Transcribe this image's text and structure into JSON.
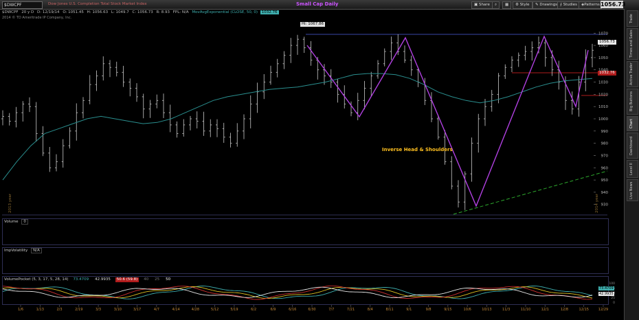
{
  "topbar": {
    "symbol": "$DWCPF",
    "description": "Dow Jones U.S. Completion Total Stock Market Index",
    "title": "Small Cap Daily",
    "buttons": [
      "Share",
      "Style",
      "Drawings",
      "Studies",
      "Patterns"
    ],
    "last_price": "1056.73"
  },
  "quote": {
    "symbol": "$DWCPF",
    "period": "20 y",
    "interval": "D",
    "date": "D: 12/19/14",
    "open": "O: 1051.45",
    "high": "H: 1056.63",
    "low": "L: 1049.7",
    "close": "C: 1056.73",
    "range": "R: 8.93",
    "fpl": "FPL: N/A",
    "study": "MovAvgExponential (CLOSE, 50, 0)",
    "study_value": "1032.76"
  },
  "copyright": "2014 © TD Ameritrade IP Company, Inc.",
  "chart_data": {
    "type": "candlestick",
    "title": "Small Cap Daily",
    "annotations": [
      "Hi: 1067.86",
      "Inverse Head & Shoulders",
      "2013 year",
      "2014 year"
    ],
    "price_labels": [
      "1056.73",
      "1032.76"
    ],
    "y_ticks": [
      930,
      940,
      950,
      960,
      970,
      980,
      990,
      1000,
      1010,
      1020,
      1030,
      1040,
      1050,
      1060,
      1070
    ],
    "ylim": [
      922,
      1078
    ],
    "x_ticks": [
      "1/6",
      "1/13",
      "2/3",
      "2/19",
      "3/3",
      "3/10",
      "3/17",
      "4/7",
      "4/14",
      "4/28",
      "5/12",
      "5/19",
      "6/2",
      "6/9",
      "6/16",
      "6/30",
      "7/7",
      "7/21",
      "8/4",
      "8/11",
      "9/1",
      "9/8",
      "9/15",
      "10/6",
      "10/13",
      "11/3",
      "11/10",
      "12/1",
      "12/8",
      "12/15",
      "12/29"
    ],
    "series": [
      {
        "name": "close",
        "values": [
          1002,
          998,
          1005,
          1012,
          1010,
          988,
          972,
          960,
          965,
          978,
          990,
          1005,
          1015,
          1028,
          1035,
          1045,
          1042,
          1038,
          1030,
          1025,
          1018,
          1008,
          1012,
          1015,
          1005,
          995,
          988,
          995,
          1000,
          998,
          990,
          995,
          992,
          985,
          980,
          990,
          1000,
          1012,
          1022,
          1030,
          1038,
          1045,
          1052,
          1060,
          1065,
          1058,
          1048,
          1040,
          1035,
          1030,
          1020,
          1012,
          1005,
          1015,
          1025,
          1035,
          1045,
          1055,
          1062,
          1055,
          1048,
          1040,
          1030,
          1015,
          1000,
          985,
          965,
          945,
          932,
          955,
          980,
          1000,
          1010,
          1020,
          1035,
          1042,
          1048,
          1052,
          1055,
          1058,
          1062,
          1050,
          1040,
          1030,
          1015,
          1008,
          1030,
          1050,
          1056
        ]
      },
      {
        "name": "MovAvgExponential (CLOSE, 50, 0)",
        "values": [
          950,
          965,
          978,
          988,
          992,
          996,
          1000,
          1002,
          1000,
          998,
          996,
          997,
          1000,
          1005,
          1010,
          1015,
          1018,
          1020,
          1022,
          1024,
          1025,
          1026,
          1028,
          1030,
          1033,
          1036,
          1037,
          1037,
          1036,
          1033,
          1028,
          1022,
          1018,
          1015,
          1013,
          1015,
          1018,
          1022,
          1026,
          1029,
          1031,
          1032,
          1033
        ]
      }
    ],
    "legend": "none"
  },
  "volume_pane": {
    "label": "Volume",
    "value": "0"
  },
  "impvol_pane": {
    "label": "ImpVolatility",
    "value": "N/A"
  },
  "vp_pane": {
    "label": "VolumePocket (5, 3, 17, 5, 28, 14)",
    "vals": [
      "73.4709",
      "42.9935",
      "50.6 (59.8)",
      "40",
      "25",
      "50"
    ],
    "right_labels": [
      "73.4709",
      "42.9935"
    ],
    "y_ticks": [
      "100",
      "75",
      "50",
      "25",
      "0"
    ]
  },
  "side_tabs": [
    "Trade",
    "Times and Sales",
    "Active Trader",
    "Big Buttons",
    "Chart",
    "Dashboard",
    "Level II",
    "Live News"
  ],
  "colors": {
    "bg": "#000000",
    "candles": "#cccccc",
    "ema": "#2a8f8f",
    "pattern": "#b040e0",
    "resistance": "#3a46a8",
    "neckline": "#b01c1c",
    "trend": "#2da82d",
    "annotation": "#ffc020"
  }
}
